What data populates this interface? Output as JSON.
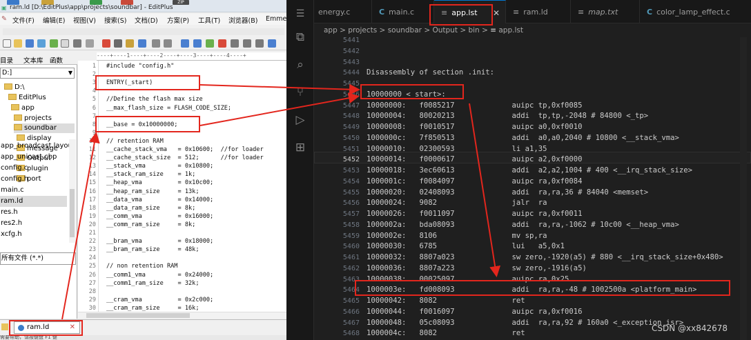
{
  "editplus": {
    "title": "ram.ld [D:\\EditPlus\\app\\projects\\soundbar] - EditPlus",
    "taskbar_badge": "ZIP",
    "menu": [
      "文件(F)",
      "编辑(E)",
      "视图(V)",
      "搜索(S)",
      "文档(D)",
      "方案(P)",
      "工具(T)",
      "浏览器(B)",
      "Emme"
    ],
    "ruler": "----+----1----+----2----+----3----+----4----+",
    "left_tabs": [
      "目录",
      "文本库",
      "函数"
    ],
    "drive": "D:]",
    "tree": [
      "D:\\",
      "EditPlus",
      "app",
      "projects",
      "soundbar",
      "display",
      "message",
      "Output",
      "plugin",
      "port"
    ],
    "files": [
      "app_broadcast.layout",
      "app_unicast.cbp",
      "config.c",
      "config.h",
      "main.c",
      "ram.ld",
      "res.h",
      "res2.h",
      "xcfg.h"
    ],
    "filter": "所有文件 (*.*)",
    "doc_tab": "ram.ld",
    "status": "需要帮助，请按键盘 F1 键",
    "code_lines": [
      {
        "n": "1",
        "t": "#include \"config.h\""
      },
      {
        "n": "2",
        "t": ""
      },
      {
        "n": "3",
        "t": "ENTRY(_start)"
      },
      {
        "n": "4",
        "t": ""
      },
      {
        "n": "5",
        "t": "//Define the flash max size"
      },
      {
        "n": "6",
        "t": "__max_flash_size = FLASH_CODE_SIZE;"
      },
      {
        "n": "7",
        "t": ""
      },
      {
        "n": "8",
        "t": "__base = 0x10000000;"
      },
      {
        "n": "9",
        "t": ""
      },
      {
        "n": "10",
        "t": "// retention RAM"
      },
      {
        "n": "11",
        "t": "__cache_stack_vma   = 0x10600;  //for loader"
      },
      {
        "n": "12",
        "t": "__cache_stack_size  = 512;      //for loader"
      },
      {
        "n": "13",
        "t": "__stack_vma         = 0x10800;"
      },
      {
        "n": "14",
        "t": "__stack_ram_size    = 1k;"
      },
      {
        "n": "15",
        "t": "__heap_vma          = 0x10c00;"
      },
      {
        "n": "16",
        "t": "__heap_ram_size     = 13k;"
      },
      {
        "n": "17",
        "t": "__data_vma          = 0x14000;"
      },
      {
        "n": "18",
        "t": "__data_ram_size     = 8k;"
      },
      {
        "n": "19",
        "t": "__comm_vma          = 0x16000;"
      },
      {
        "n": "20",
        "t": "__comm_ram_size     = 8k;"
      },
      {
        "n": "21",
        "t": ""
      },
      {
        "n": "22",
        "t": "__bram_vma          = 0x18000;"
      },
      {
        "n": "23",
        "t": "__bram_ram_size     = 48k;"
      },
      {
        "n": "24",
        "t": ""
      },
      {
        "n": "25",
        "t": "// non retention RAM"
      },
      {
        "n": "26",
        "t": "__comm1_vma         = 0x24000;"
      },
      {
        "n": "27",
        "t": "__comm1_ram_size    = 32k;"
      },
      {
        "n": "28",
        "t": ""
      },
      {
        "n": "29",
        "t": "__cram_vma          = 0x2c000;"
      },
      {
        "n": "30",
        "t": "__cram_ram_size     = 16k;"
      }
    ]
  },
  "vscode": {
    "tabs": [
      {
        "label": "energy.c",
        "icon": "C"
      },
      {
        "label": "main.c",
        "icon": "C"
      },
      {
        "label": "app.lst",
        "icon": "≡"
      },
      {
        "label": "ram.ld",
        "icon": "≡"
      },
      {
        "label": "map.txt",
        "icon": "≡"
      },
      {
        "label": "color_lamp_effect.c",
        "icon": "C"
      }
    ],
    "close_glyph": "✕",
    "breadcrumb": [
      "app",
      "projects",
      "soundbar",
      "Output",
      "bin",
      "app.lst"
    ],
    "breadcrumb_sep": ">",
    "watermark": "CSDN @xx842678",
    "lines": [
      {
        "n": "5441",
        "t": ""
      },
      {
        "n": "5442",
        "t": ""
      },
      {
        "n": "5443",
        "t": ""
      },
      {
        "n": "5444",
        "t": "Disassembly of section .init:"
      },
      {
        "n": "5445",
        "t": ""
      },
      {
        "n": "5446",
        "t": "10000000 <_start>:"
      },
      {
        "n": "5447",
        "t": "10000000:   f0085217             auipc tp,0xf0085"
      },
      {
        "n": "5448",
        "t": "10000004:   80020213             addi  tp,tp,-2048 # 84800 <_tp>"
      },
      {
        "n": "5449",
        "t": "10000008:   f0010517             auipc a0,0xf0010"
      },
      {
        "n": "5450",
        "t": "1000000c:   7f850513             addi  a0,a0,2040 # 10800 <__stack_vma>"
      },
      {
        "n": "5451",
        "t": "10000010:   02300593             li a1,35"
      },
      {
        "n": "5452",
        "t": "10000014:   f0000617             auipc a2,0xf0000"
      },
      {
        "n": "5453",
        "t": "10000018:   3ec60613             addi  a2,a2,1004 # 400 <__irq_stack_size>"
      },
      {
        "n": "5454",
        "t": "1000001c:   f0084097             auipc ra,0xf0084"
      },
      {
        "n": "5455",
        "t": "10000020:   02408093             addi  ra,ra,36 # 84040 <memset>"
      },
      {
        "n": "5456",
        "t": "10000024:   9082                 jalr  ra"
      },
      {
        "n": "5457",
        "t": "10000026:   f0011097             auipc ra,0xf0011"
      },
      {
        "n": "5458",
        "t": "1000002a:   bda08093             addi  ra,ra,-1062 # 10c00 <__heap_vma>"
      },
      {
        "n": "5459",
        "t": "1000002e:   8106                 mv sp,ra"
      },
      {
        "n": "5460",
        "t": "10000030:   6785                 lui   a5,0x1"
      },
      {
        "n": "5461",
        "t": "10000032:   8807a023             sw zero,-1920(a5) # 880 <__irq_stack_size+0x480>"
      },
      {
        "n": "5462",
        "t": "10000036:   8807a223             sw zero,-1916(a5)"
      },
      {
        "n": "5463",
        "t": "10000038:   00025097             auipc ra,0x25"
      },
      {
        "n": "5464",
        "t": "1000003e:   fd008093             addi  ra,ra,-48 # 1002500a <platform_main>"
      },
      {
        "n": "5465",
        "t": "10000042:   8082                 ret"
      },
      {
        "n": "5466",
        "t": "10000044:   f0016097             auipc ra,0xf0016"
      },
      {
        "n": "5467",
        "t": "10000048:   05c08093             addi  ra,ra,92 # 160a0 <_exception_isr>"
      },
      {
        "n": "5468",
        "t": "1000004c:   8082                 ret"
      }
    ],
    "accent": "#0078d4"
  },
  "annotation_color": "#e3261d"
}
